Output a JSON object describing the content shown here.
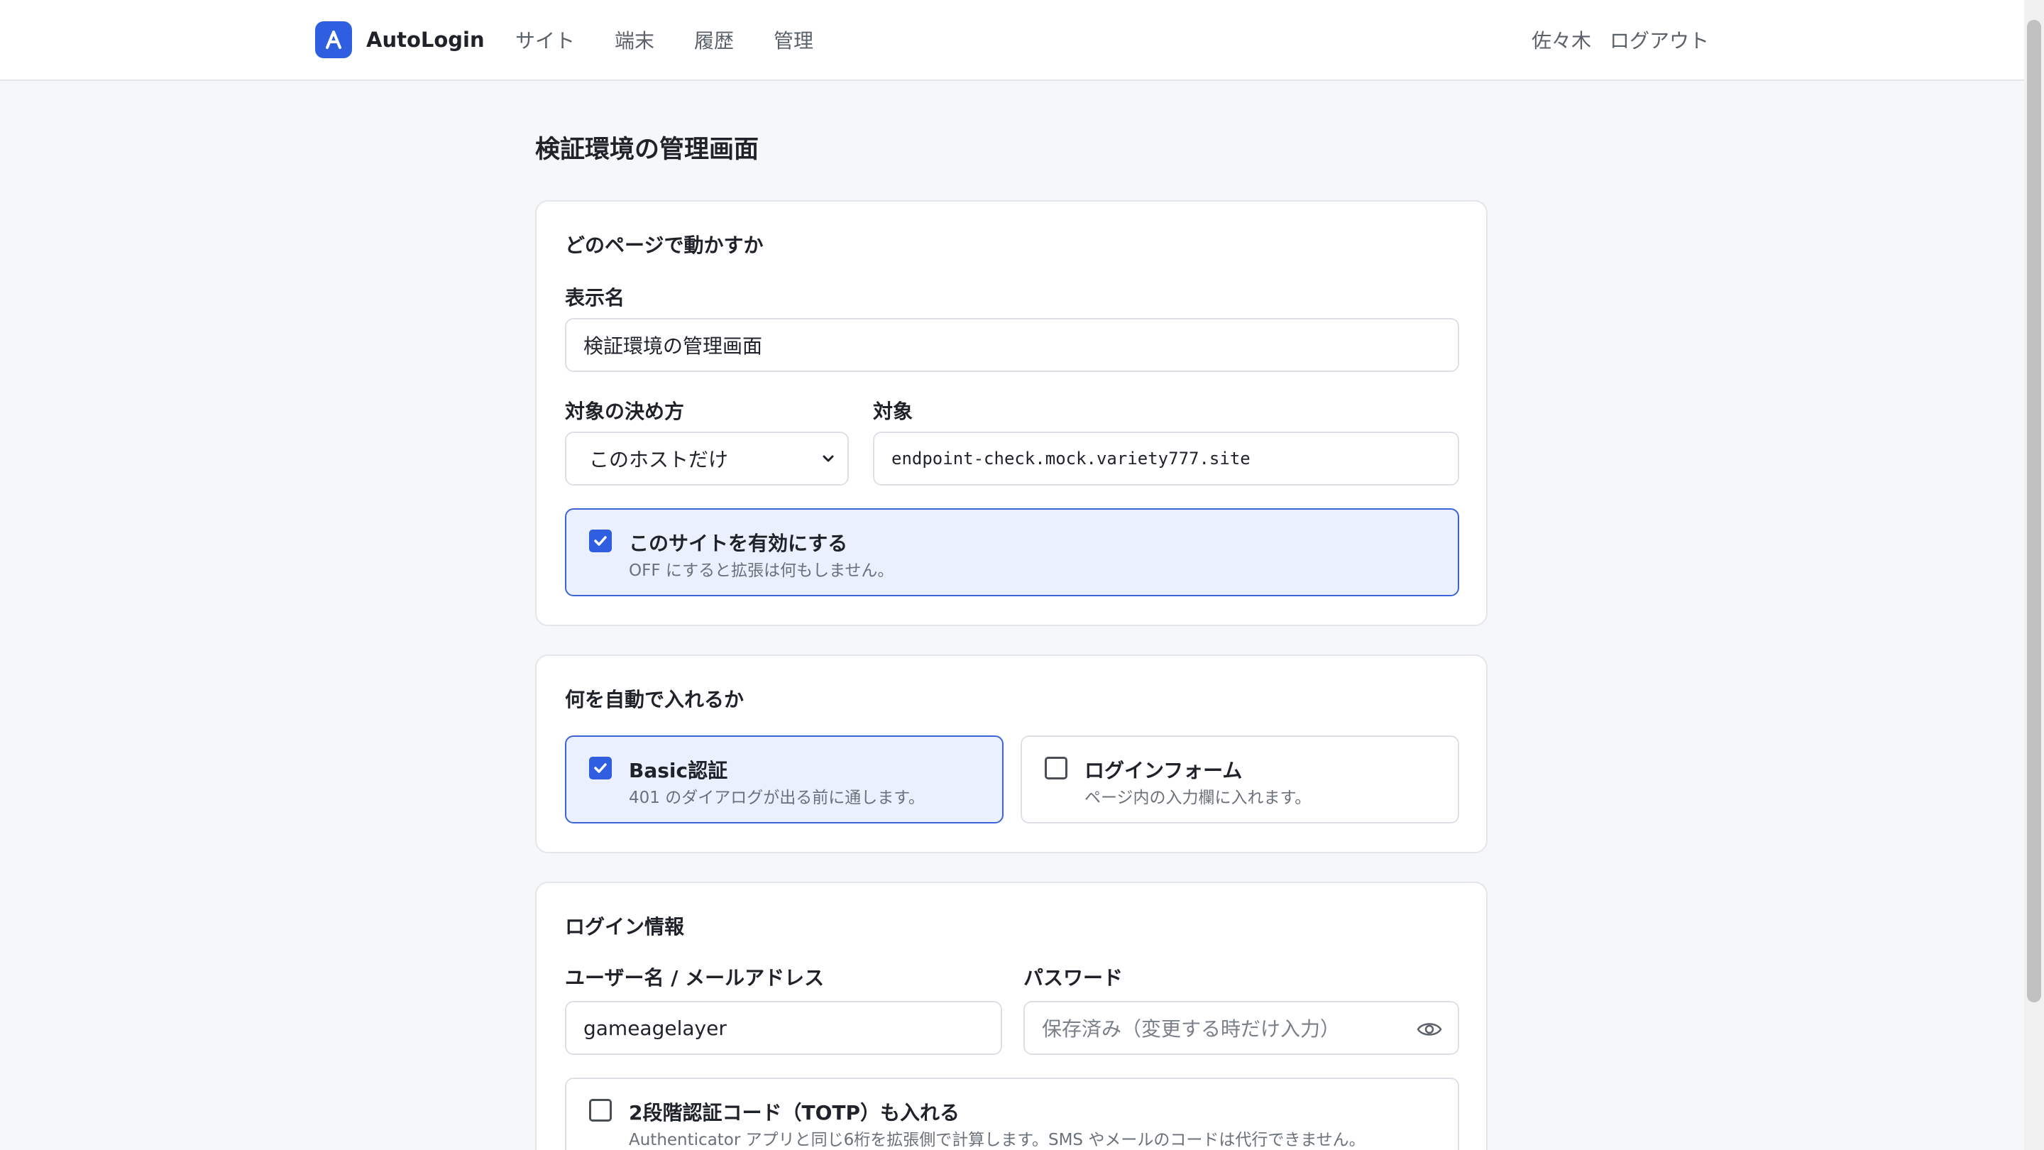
{
  "header": {
    "app_name": "AutoLogin",
    "nav": [
      "サイト",
      "端末",
      "履歴",
      "管理"
    ],
    "user_name": "佐々木",
    "logout_label": "ログアウト"
  },
  "page": {
    "title": "検証環境の管理画面"
  },
  "section_target": {
    "title": "どのページで動かすか",
    "display_name_label": "表示名",
    "display_name_value": "検証環境の管理画面",
    "match_method_label": "対象の決め方",
    "match_method_value": "このホストだけ",
    "target_label": "対象",
    "target_value": "endpoint-check.mock.variety777.site",
    "enable_title": "このサイトを有効にする",
    "enable_desc": "OFF にすると拡張は何もしません。",
    "enable_checked": true
  },
  "section_fill": {
    "title": "何を自動で入れるか",
    "basic_title": "Basic認証",
    "basic_desc": "401 のダイアログが出る前に通します。",
    "basic_checked": true,
    "form_title": "ログインフォーム",
    "form_desc": "ページ内の入力欄に入れます。",
    "form_checked": false
  },
  "section_login": {
    "title": "ログイン情報",
    "username_label": "ユーザー名 / メールアドレス",
    "username_value": "gameagelayer",
    "password_label": "パスワード",
    "password_placeholder": "保存済み（変更する時だけ入力）",
    "totp_title": "2段階認証コード（TOTP）も入れる",
    "totp_desc": "Authenticator アプリと同じ6桁を拡張側で計算します。SMS やメールのコードは代行できません。",
    "totp_checked": false
  },
  "colors": {
    "accent": "#2f5fe0",
    "selected_bg": "#ebf0fe",
    "selected_border": "#3d63d9"
  },
  "icons": [
    "autologin-logo-icon",
    "chevron-down-icon",
    "checkbox-checked-icon",
    "checkbox-unchecked-icon",
    "eye-icon"
  ]
}
